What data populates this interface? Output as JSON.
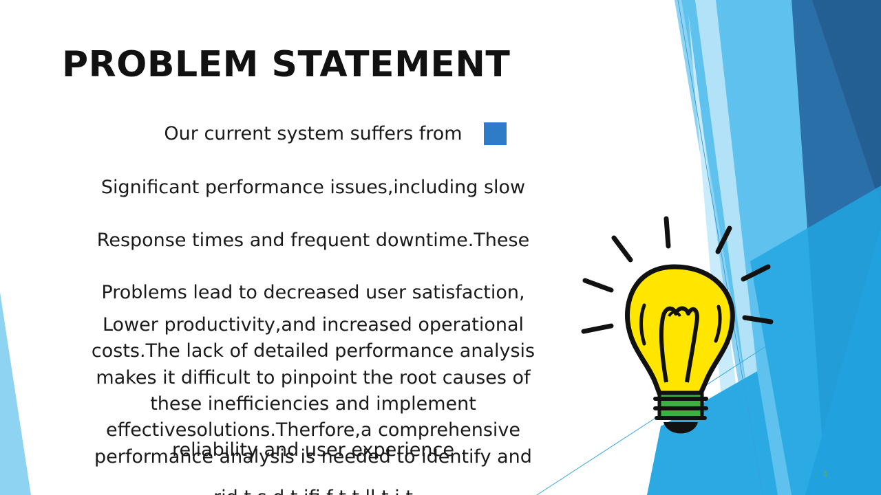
{
  "slide": {
    "title": "PROBLEM STATEMENT",
    "lines": [
      "Our current system suffers from",
      "Significant performance issues,including slow",
      "Response times and frequent downtime.These",
      "Problems lead to decreased user satisfaction,",
      "Lower productivity,and increased operational",
      "costs.The lack of detailed performance analysis",
      "makes it difficult to pinpoint the root causes of",
      "these inefficiencies and implement",
      "effectivesolutions.Therfore,a comprehensive",
      "performance analysis is needed to identify and"
    ],
    "overlapping_text": "reliability and user experience",
    "cutoff_text": "rid  t  s  d  t  ifi  f  t  t  ll  t  i  t",
    "page_number": "4"
  },
  "colors": {
    "accent_square": "#2e7cc7",
    "page_number": "#6aa84f",
    "bulb_yellow": "#ffe600",
    "bulb_base_green": "#3cb043"
  },
  "icons": {
    "bulb": "lightbulb-icon"
  }
}
